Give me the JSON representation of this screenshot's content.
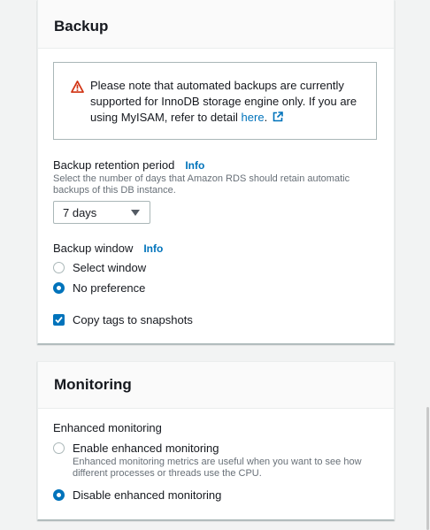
{
  "backup": {
    "title": "Backup",
    "warning": {
      "text": "Please note that automated backups are currently supported for InnoDB storage engine only. If you are using MyISAM, refer to detail",
      "link": "here",
      "after_link": ".",
      "icon": "warning-icon"
    },
    "retention": {
      "label": "Backup retention period",
      "info": "Info",
      "description": "Select the number of days that Amazon RDS should retain automatic backups of this DB instance.",
      "selected": "7 days"
    },
    "window": {
      "label": "Backup window",
      "info": "Info",
      "options": [
        {
          "label": "Select window",
          "checked": false
        },
        {
          "label": "No preference",
          "checked": true
        }
      ]
    },
    "copy_tags": {
      "label": "Copy tags to snapshots",
      "checked": true
    }
  },
  "monitoring": {
    "title": "Monitoring",
    "enhanced": {
      "label": "Enhanced monitoring",
      "options": [
        {
          "label": "Enable enhanced monitoring",
          "description": "Enhanced monitoring metrics are useful when you want to see how different processes or threads use the CPU.",
          "checked": false
        },
        {
          "label": "Disable enhanced monitoring",
          "checked": true
        }
      ]
    }
  },
  "colors": {
    "accent": "#0073bb",
    "warning": "#d13212",
    "text": "#16191f",
    "muted": "#687078"
  }
}
